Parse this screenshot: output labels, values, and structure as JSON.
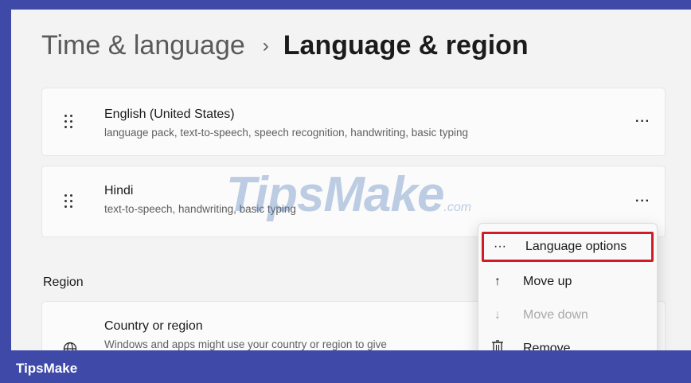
{
  "breadcrumb": {
    "parent": "Time & language",
    "separator": "›",
    "current": "Language & region"
  },
  "languages": [
    {
      "name": "English (United States)",
      "features": "language pack, text-to-speech, speech recognition, handwriting, basic typing",
      "more": "···"
    },
    {
      "name": "Hindi",
      "features": "text-to-speech, handwriting, basic typing",
      "more": "···"
    }
  ],
  "region": {
    "section_label": "Region",
    "title": "Country or region",
    "description": "Windows and apps might use your country or region to give",
    "icon": "globe-icon"
  },
  "context_menu": {
    "items": [
      {
        "icon": "···",
        "label": "Language options",
        "selected": true
      },
      {
        "icon": "↑",
        "label": "Move up"
      },
      {
        "icon": "↓",
        "label": "Move down",
        "disabled": true
      },
      {
        "icon": "trash-icon",
        "label": "Remove"
      }
    ],
    "highlight_color": "#d01c24"
  },
  "watermark": {
    "main": "TipsMake",
    "suffix": ".com"
  },
  "footer": {
    "brand": "TipsMake",
    "color": "#3f4aa8"
  }
}
